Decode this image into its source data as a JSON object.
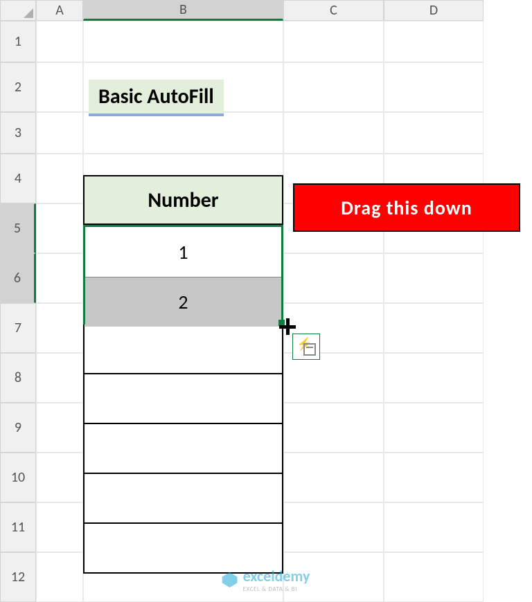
{
  "columns": [
    "A",
    "B",
    "C",
    "D"
  ],
  "rows": [
    "1",
    "2",
    "3",
    "4",
    "5",
    "6",
    "7",
    "8",
    "9",
    "10",
    "11",
    "12"
  ],
  "selected_column": "B",
  "selected_rows": [
    "5",
    "6"
  ],
  "title": "Basic AutoFill",
  "table": {
    "header": "Number",
    "cells": [
      "1",
      "2",
      "",
      "",
      "",
      "",
      ""
    ]
  },
  "callout_text": "Drag this down",
  "watermark": {
    "brand": "exceldemy",
    "tagline": "EXCEL & DATA & BI"
  },
  "chart_data": {
    "type": "table",
    "title": "Basic AutoFill",
    "columns": [
      "Number"
    ],
    "rows": [
      [
        1
      ],
      [
        2
      ],
      [
        null
      ],
      [
        null
      ],
      [
        null
      ],
      [
        null
      ],
      [
        null
      ]
    ]
  }
}
